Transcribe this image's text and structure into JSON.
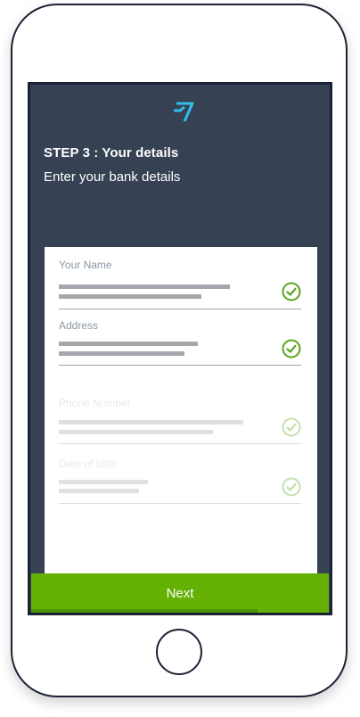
{
  "header": {
    "logo_icon": "wise-flag-logo",
    "title": "STEP 3 : Your details",
    "subtitle": "Enter your bank details"
  },
  "form": {
    "fields": [
      {
        "label": "Your Name",
        "state": "complete",
        "icon": "check-circle-icon"
      },
      {
        "label": "Address",
        "state": "complete",
        "icon": "check-circle-icon"
      },
      {
        "label": "Phone Number",
        "state": "pending",
        "icon": "check-circle-icon"
      },
      {
        "label": "Date of birth",
        "state": "pending",
        "icon": "check-circle-icon"
      }
    ]
  },
  "footer": {
    "next_label": "Next",
    "progress_fraction": 0.76
  },
  "colors": {
    "screen_bg": "#364153",
    "accent_green": "#64b004",
    "check_green": "#5aa51c",
    "logo_blue": "#2fc0ea"
  }
}
